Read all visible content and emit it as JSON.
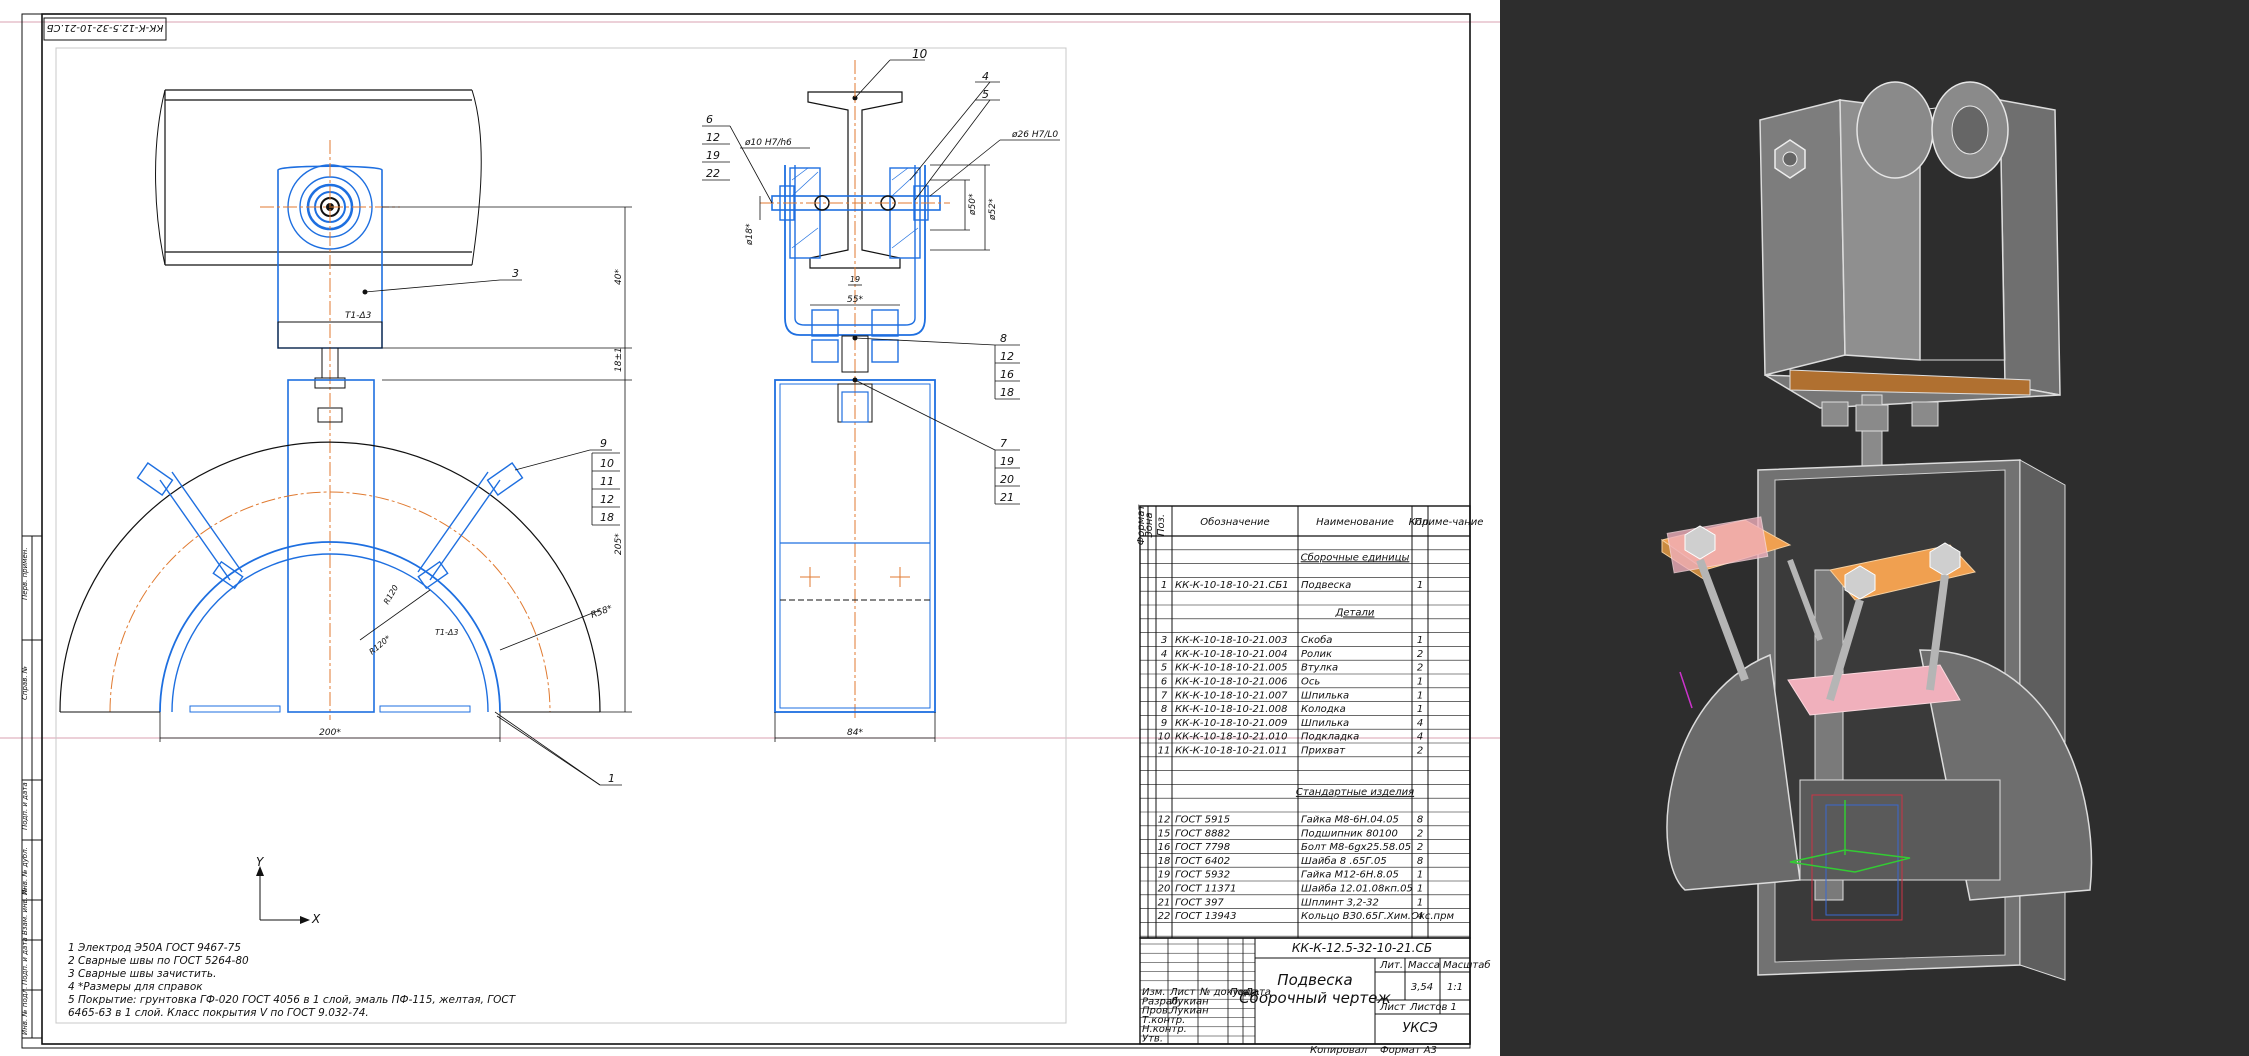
{
  "drawing": {
    "corner_stamp": "КК-К-12.5-32-10-21.СБ",
    "part_title_line1": "Подвеска",
    "part_title_line2": "Сборочный чертеж",
    "designation": "КК-К-12.5-32-10-21.СБ",
    "mass": "3,54",
    "scale": "1:1",
    "sheet_label": "Лист",
    "sheets_label": "Листов 1",
    "org": "УКСЭ",
    "format": "Формат А3",
    "copied": "Копировал",
    "dim_top": "40*",
    "dim_mid": "18±1",
    "dim_big": "205*",
    "dim_width": "200*",
    "dim_r": "R58*",
    "dim_r2": "R120*",
    "dim_r3": "R120",
    "dim_width_side": "84*",
    "dim_55": "55*",
    "dim_d1": "ø10 Н7/h6",
    "dim_d2": "ø26 Н7/L0",
    "dim_d3": "ø52*",
    "dim_d4": "ø50*",
    "dim_d5": "ø18*",
    "dim_19": "19",
    "weld_mark": "T1-Δ3",
    "axis_y": "Y",
    "axis_x": "X",
    "left_strip": [
      "Перв. примен.",
      "Справ. №",
      "Подп. и дата",
      "Инв. № дубл.",
      "Взам. инв. №",
      "Подп. и дата",
      "Инв. № подл."
    ],
    "title_block_left": [
      [
        "Изм.",
        "Лист",
        "№ докум.",
        "Подп.",
        "Дата"
      ],
      [
        "Разраб.",
        "Лукиан",
        "",
        "",
        ""
      ],
      [
        "Пров.",
        "Лукиан",
        "",
        "",
        ""
      ],
      [
        "Т.контр.",
        "",
        "",
        "",
        ""
      ],
      [
        "Н.контр.",
        "",
        "",
        "",
        ""
      ],
      [
        "Утв.",
        "",
        "",
        "",
        ""
      ]
    ],
    "title_block_hdr": [
      "Лит.",
      "Масса",
      "Масштаб"
    ]
  },
  "notes": [
    "1  Электрод Э50А ГОСТ 9467-75",
    "2  Сварные швы по ГОСТ 5264-80",
    "3  Сварные швы зачистить.",
    "4  *Размеры для справок",
    "5  Покрытие: грунтовка ГФ-020 ГОСТ 4056 в 1 слой, эмаль ПФ-115, желтая, ГОСТ",
    "6465-63 в 1 слой. Класс покрытия V по ГОСТ 9.032-74."
  ],
  "leaders_front": [
    "3",
    "9",
    "10",
    "11",
    "12",
    "18",
    "1"
  ],
  "leaders_side_left": [
    "6",
    "12",
    "19",
    "22"
  ],
  "leaders_side_top": [
    "10",
    "4",
    "5"
  ],
  "leaders_side_right_a": [
    "8",
    "12",
    "16",
    "18"
  ],
  "leaders_side_right_b": [
    "7",
    "19",
    "20",
    "21"
  ],
  "spec": {
    "headers": [
      "Формат",
      "Зона",
      "Поз.",
      "Обозначение",
      "Наименование",
      "Кол.",
      "Приме-чание"
    ],
    "section_assembly": "Сборочные единицы",
    "section_details": "Детали",
    "section_standard": "Стандартные изделия",
    "rows_assembly": [
      {
        "pos": "1",
        "code": "КК-К-10-18-10-21.СБ1",
        "name": "Подвеска",
        "qty": "1"
      }
    ],
    "rows_details": [
      {
        "pos": "3",
        "code": "КК-К-10-18-10-21.003",
        "name": "Скоба",
        "qty": "1"
      },
      {
        "pos": "4",
        "code": "КК-К-10-18-10-21.004",
        "name": "Ролик",
        "qty": "2"
      },
      {
        "pos": "5",
        "code": "КК-К-10-18-10-21.005",
        "name": "Втулка",
        "qty": "2"
      },
      {
        "pos": "6",
        "code": "КК-К-10-18-10-21.006",
        "name": "Ось",
        "qty": "1"
      },
      {
        "pos": "7",
        "code": "КК-К-10-18-10-21.007",
        "name": "Шпилька",
        "qty": "1"
      },
      {
        "pos": "8",
        "code": "КК-К-10-18-10-21.008",
        "name": "Колодка",
        "qty": "1"
      },
      {
        "pos": "9",
        "code": "КК-К-10-18-10-21.009",
        "name": "Шпилька",
        "qty": "4"
      },
      {
        "pos": "10",
        "code": "КК-К-10-18-10-21.010",
        "name": "Подкладка",
        "qty": "4"
      },
      {
        "pos": "11",
        "code": "КК-К-10-18-10-21.011",
        "name": "Прихват",
        "qty": "2"
      }
    ],
    "rows_standard": [
      {
        "pos": "12",
        "code": "ГОСТ 5915",
        "name": "Гайка М8-6Н.04.05",
        "qty": "8"
      },
      {
        "pos": "15",
        "code": "ГОСТ 8882",
        "name": "Подшипник 80100",
        "qty": "2"
      },
      {
        "pos": "16",
        "code": "ГОСТ 7798",
        "name": "Болт М8-6gх25.58.05",
        "qty": "2"
      },
      {
        "pos": "18",
        "code": "ГОСТ 6402",
        "name": "Шайба 8 .65Г.05",
        "qty": "8"
      },
      {
        "pos": "19",
        "code": "ГОСТ 5932",
        "name": "Гайка М12-6Н.8.05",
        "qty": "1"
      },
      {
        "pos": "20",
        "code": "ГОСТ 11371",
        "name": "Шайба 12.01.08кп.05",
        "qty": "1"
      },
      {
        "pos": "21",
        "code": "ГОСТ 397",
        "name": "Шплинт 3,2-32",
        "qty": "1"
      },
      {
        "pos": "22",
        "code": "ГОСТ 13943",
        "name": "Кольцо ВЗ0.65Г.Хим.Окс.прм",
        "qty": "4"
      }
    ]
  },
  "colors": {
    "bg_viewport": "#2d2d2d",
    "selected_blue": "#1e6fe0",
    "orange_plate": "#f0a050",
    "pink_plate": "#f0b0bc",
    "grey_body": "#8a8a8a",
    "red_axis": "#cc3344",
    "green_axis": "#33cc33"
  }
}
